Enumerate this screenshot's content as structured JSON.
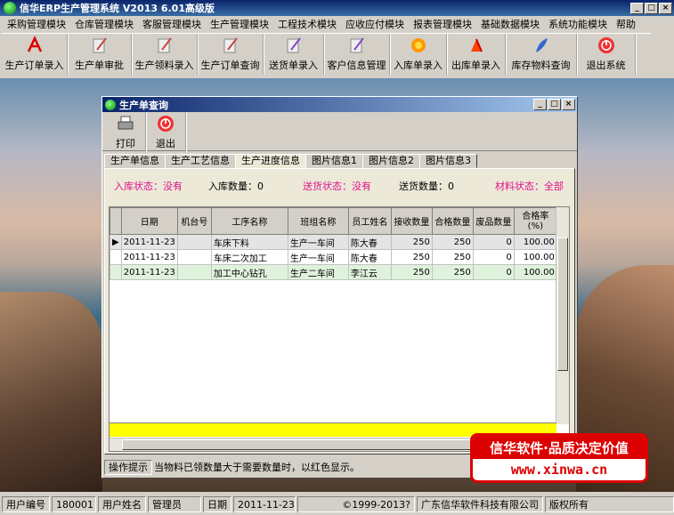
{
  "app": {
    "title": "信华ERP生产管理系统   V2013 6.01高级版"
  },
  "menu": [
    "采购管理模块",
    "仓库管理模块",
    "客服管理模块",
    "生产管理模块",
    "工程技术模块",
    "应收应付模块",
    "报表管理模块",
    "基础数据模块",
    "系统功能模块",
    "帮助"
  ],
  "toolbar": [
    {
      "label": "生产订单录入",
      "icon": "pdf-icon"
    },
    {
      "label": "生产单审批",
      "icon": "pen-paper-icon"
    },
    {
      "label": "生产领料录入",
      "icon": "pen-paper-icon"
    },
    {
      "label": "生产订单查询",
      "icon": "pen-paper-icon"
    },
    {
      "label": "送货单录入",
      "icon": "pen-paper-icon"
    },
    {
      "label": "客户信息管理",
      "icon": "pen-paper-icon"
    },
    {
      "label": "入库单录入",
      "icon": "flower-icon"
    },
    {
      "label": "出库单录入",
      "icon": "pen-paper-icon"
    },
    {
      "label": "库存物料查询",
      "icon": "feather-icon"
    },
    {
      "label": "退出系统",
      "icon": "power-icon"
    }
  ],
  "child": {
    "title": "生产单查询",
    "tools": [
      {
        "label": "打印",
        "icon": "printer-icon"
      },
      {
        "label": "退出",
        "icon": "power-icon"
      }
    ],
    "tabs": [
      "生产单信息",
      "生产工艺信息",
      "生产进度信息",
      "图片信息1",
      "图片信息2",
      "图片信息3"
    ],
    "active_tab": "生产进度信息",
    "status": {
      "in_state": "入库状态：没有",
      "in_qty": "入库数量：0",
      "ship_state": "送货状态：没有",
      "ship_qty": "送货数量：0",
      "material_state": "材料状态：全部"
    },
    "grid": {
      "headers": [
        "日期",
        "机台号",
        "工序名称",
        "班组名称",
        "员工姓名",
        "接收数量",
        "合格数量",
        "废品数量",
        "合格率\n(%)"
      ],
      "rows": [
        [
          "2011-11-23",
          "",
          "车床下料",
          "生产一车间",
          "陈大春",
          "250",
          "250",
          "0",
          "100.00"
        ],
        [
          "2011-11-23",
          "",
          "车床二次加工",
          "生产一车间",
          "陈大春",
          "250",
          "250",
          "0",
          "100.00"
        ],
        [
          "2011-11-23",
          "",
          "加工中心钻孔",
          "生产二车间",
          "李江云",
          "250",
          "250",
          "0",
          "100.00"
        ]
      ]
    },
    "hint_label": "操作提示",
    "hint_text": "当物料已领数量大于需要数量时，以红色显示。"
  },
  "ad": {
    "line1": "信华软件·品质决定价值",
    "line2": "www.xinwa.cn"
  },
  "statusbar": {
    "user_no_label": "用户编号",
    "user_no": "180001",
    "user_name_label": "用户姓名",
    "user_name": "管理员",
    "date_label": "日期",
    "date": "2011-11-23",
    "copyright": "©1999-2013?",
    "company": "广东信华软件科技有限公司",
    "rights": "版权所有"
  },
  "colors": {
    "title_bar": "#0a246a",
    "pink": "#e0108a",
    "sum_row": "#ffff00",
    "ad_red": "#dd0000"
  }
}
